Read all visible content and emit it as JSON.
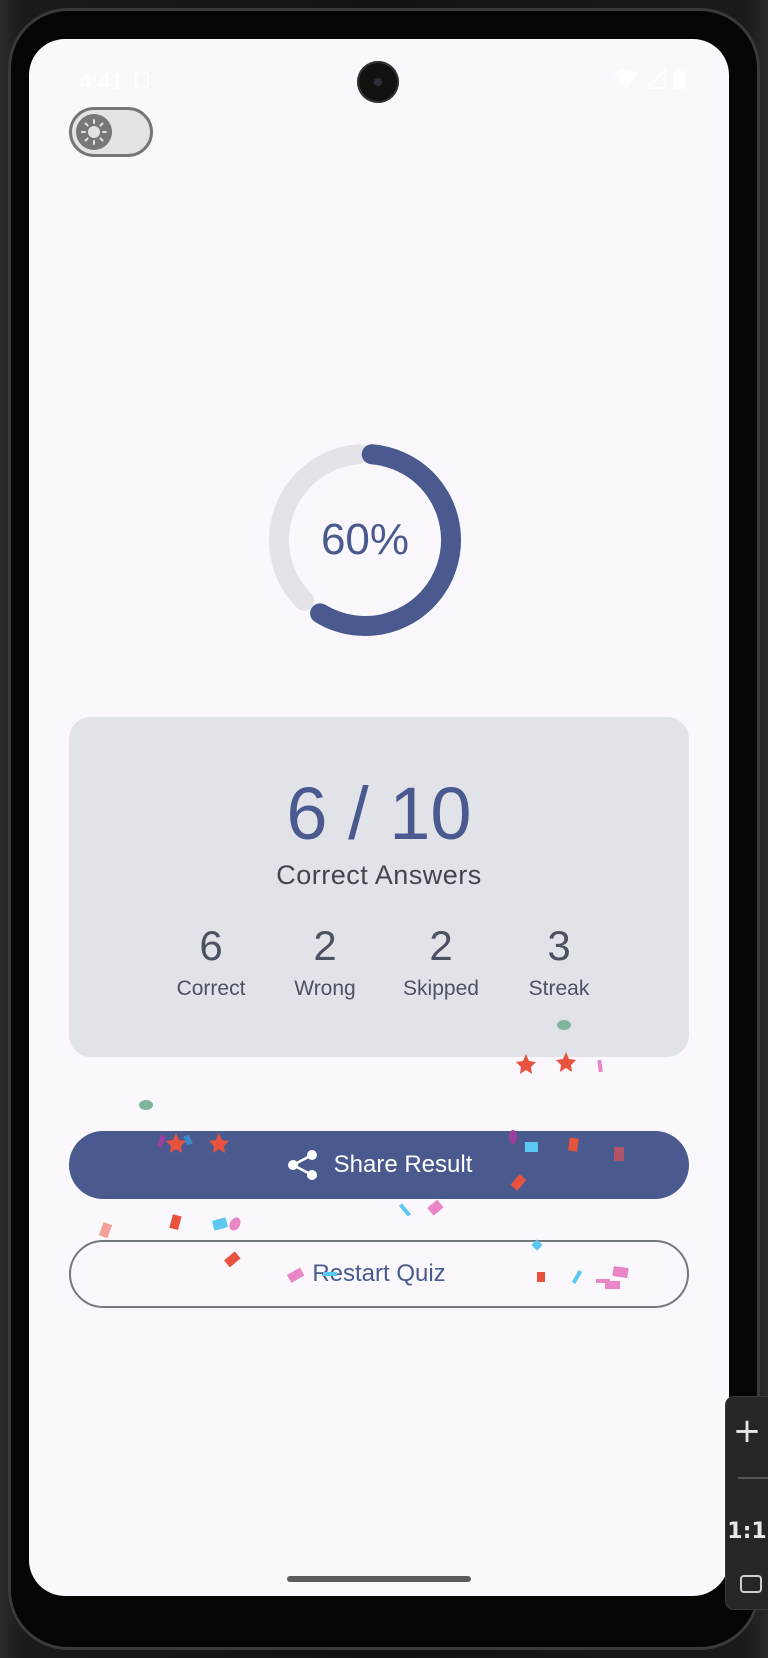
{
  "status_bar": {
    "time": "4:41",
    "icons": [
      "sim-card-icon",
      "wifi-icon",
      "signal-icon",
      "battery-icon"
    ]
  },
  "theme_toggle": {
    "icon": "sun-icon",
    "checked": false
  },
  "progress": {
    "percent_label": "60%",
    "fraction": 0.6,
    "colors": {
      "fill": "#4a5a8e",
      "track": "#e3e3e9"
    }
  },
  "score": {
    "main": "6 / 10",
    "caption": "Correct Answers",
    "stats": [
      {
        "value": "6",
        "label": "Correct"
      },
      {
        "value": "2",
        "label": "Wrong"
      },
      {
        "value": "2",
        "label": "Skipped"
      },
      {
        "value": "3",
        "label": "Streak"
      }
    ]
  },
  "actions": {
    "share_label": "Share Result",
    "share_icon": "share-icon",
    "restart_label": "Restart Quiz"
  },
  "emulator_toolbar": {
    "zoom_in": "+",
    "zoom_out": "—",
    "zoom_level": "1:1",
    "fit_icon": "fit-screen-icon"
  },
  "colors": {
    "primary": "#4a5a8e",
    "background": "#fbf8fd",
    "card": "#e2e2e9",
    "outline": "#75777f",
    "confetti": [
      "#e8533f",
      "#5ac8f0",
      "#e886c6",
      "#7fb59a",
      "#9a3fa0",
      "#b0546a",
      "#f4a19a"
    ]
  }
}
